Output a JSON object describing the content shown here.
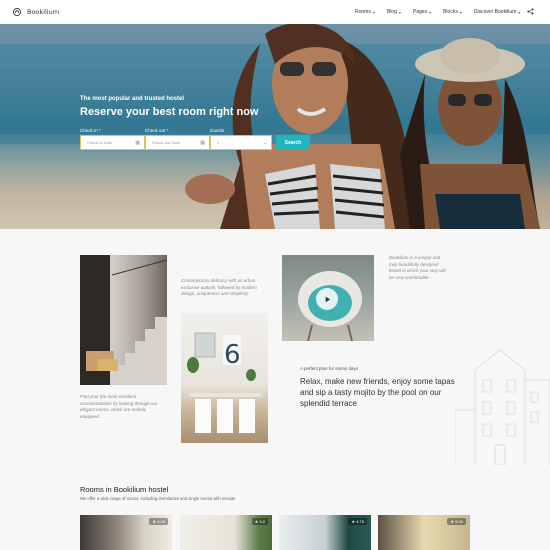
{
  "brand": {
    "name": "Bookilium"
  },
  "nav": {
    "items": [
      {
        "label": "Rooms"
      },
      {
        "label": "Blog"
      },
      {
        "label": "Pages"
      },
      {
        "label": "Blocks"
      },
      {
        "label": "Discover Bookilium"
      }
    ]
  },
  "hero": {
    "subtitle": "The most popular and trusted hostel",
    "title": "Reserve your best room right now",
    "form": {
      "checkin_label": "Check In *",
      "checkin_placeholder": "Check-in Date",
      "checkout_label": "Check out *",
      "checkout_placeholder": "Check-out Date",
      "guests_label": "Guests",
      "guests_value": "1",
      "search_label": "Search"
    }
  },
  "about": {
    "text_contemporary": "Contemporary delicacy with an urban exclusive outlook, followed by modern design, uniqueness and simplicity.",
    "text_accommodation": "Find your the most excellent accommodation by looking through our elegant rooms, which are entirely equipped.",
    "text_unique": "Bookilium is a unique and truly beautifully designed hostel in which your stay will be very comfortable.",
    "perfect_plan": "A perfect plan for sunny days",
    "quote": "Relax, make new friends, enjoy some tapas and sip a tasty mojito by the pool on our splendid terrace"
  },
  "rooms": {
    "title": "Rooms in Bookilium hostel",
    "subtitle": "We offer a wide range of rooms, including dormitories and single rooms with ensuite",
    "cards": [
      {
        "rating": "4.29"
      },
      {
        "rating": "5.0"
      },
      {
        "rating": "4.75"
      },
      {
        "rating": "5.00"
      }
    ]
  },
  "colors": {
    "accent": "#20b6bb",
    "field_border": "#d8c45a",
    "section_bg": "#f7f7f7"
  }
}
